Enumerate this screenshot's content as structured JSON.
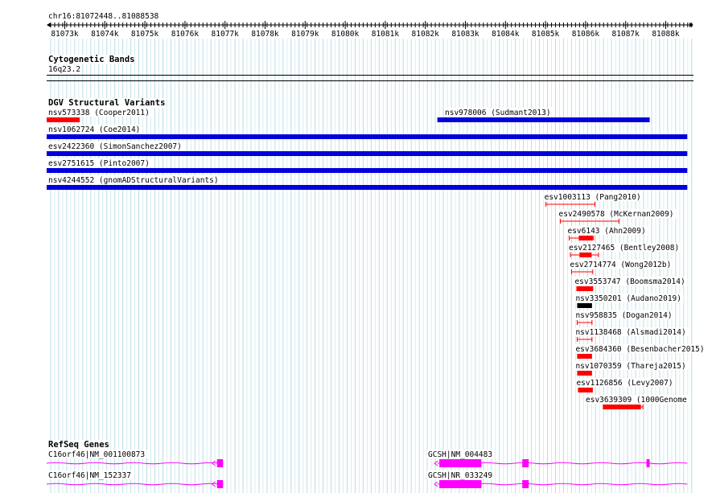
{
  "ruler": {
    "location": "chr16:81072448..81088538",
    "ticks": [
      "81073k",
      "81074k",
      "81075k",
      "81076k",
      "81077k",
      "81078k",
      "81079k",
      "81080k",
      "81081k",
      "81082k",
      "81083k",
      "81084k",
      "81085k",
      "81086k",
      "81087k",
      "81088k"
    ]
  },
  "cytoband": {
    "title": "Cytogenetic Bands",
    "band": "16q23.2"
  },
  "dgv": {
    "title": "DGV Structural Variants",
    "variants": [
      {
        "label": "nsv573338 (Cooper2011)",
        "start": 81072448,
        "end": 81073375,
        "color": "#ff0000",
        "style": "bar"
      },
      {
        "label": "nsv978006 (Sudmant2013)",
        "start": 81082300,
        "end": 81087600,
        "color": "#0000dd",
        "style": "bar"
      },
      {
        "label": "nsv1062724 (Coe2014)",
        "start": 81072448,
        "end": 81088538,
        "color": "#0000dd",
        "style": "bar"
      },
      {
        "label": "esv2422360 (SimonSanchez2007)",
        "start": 81072448,
        "end": 81088538,
        "color": "#0000dd",
        "style": "bar"
      },
      {
        "label": "esv2751615 (Pinto2007)",
        "start": 81072448,
        "end": 81088538,
        "color": "#0000dd",
        "style": "bar"
      },
      {
        "label": "nsv4244552 (gnomADStructuralVariants)",
        "start": 81072448,
        "end": 81088538,
        "color": "#0000dd",
        "style": "bar"
      },
      {
        "label": "esv1003113 (Pang2010)",
        "start": 81085010,
        "end": 81086230,
        "color": "#ff0000",
        "style": "span"
      },
      {
        "label": "esv2490578 (McKernan2009)",
        "start": 81085370,
        "end": 81086830,
        "color": "#ff0000",
        "style": "span"
      },
      {
        "label": "esv6143 (Ahn2009)",
        "start": 81085590,
        "end": 81086200,
        "color": "#ff0000",
        "style": "span-box",
        "box": [
          81085830,
          81086180
        ]
      },
      {
        "label": "esv2127465 (Bentley2008)",
        "start": 81085620,
        "end": 81086320,
        "color": "#ff0000",
        "style": "span-box",
        "box": [
          81085850,
          81086150
        ]
      },
      {
        "label": "esv2714774 (Wong2012b)",
        "start": 81085650,
        "end": 81086180,
        "color": "#ff0000",
        "style": "span"
      },
      {
        "label": "esv3553747 (Boomsma2014)",
        "start": 81085770,
        "end": 81086190,
        "color": "#ff0000",
        "style": "bar"
      },
      {
        "label": "nsv3350201 (Audano2019)",
        "start": 81085790,
        "end": 81086160,
        "color": "#000000",
        "style": "bar"
      },
      {
        "label": "nsv958835 (Dogan2014)",
        "start": 81085790,
        "end": 81086160,
        "color": "#ff0000",
        "style": "span"
      },
      {
        "label": "nsv1138468 (Alsmadi2014)",
        "start": 81085790,
        "end": 81086160,
        "color": "#ff0000",
        "style": "span"
      },
      {
        "label": "esv3684360 (Besenbacher2015)",
        "start": 81085790,
        "end": 81086160,
        "color": "#ff0000",
        "style": "bar"
      },
      {
        "label": "nsv1070359 (Thareja2015)",
        "start": 81085790,
        "end": 81086160,
        "color": "#ff0000",
        "style": "bar"
      },
      {
        "label": "esv1126856 (Levy2007)",
        "start": 81085810,
        "end": 81086180,
        "color": "#ff0000",
        "style": "bar"
      },
      {
        "label": "esv3639309 (1000Genome",
        "start": 81086440,
        "end": 81087430,
        "color": "#ff0000",
        "style": "span-box",
        "box": [
          81086440,
          81087380
        ]
      }
    ]
  },
  "refseq": {
    "title": "RefSeq Genes",
    "genes": [
      {
        "label": "C16orf46|NM_001100873",
        "color": "#ff00ff",
        "start": 81072448,
        "end": 81076950,
        "exons": [
          [
            81076800,
            81076950
          ]
        ],
        "arrow": "left"
      },
      {
        "label": "GCSH|NM_004483",
        "color": "#ff00ff",
        "start": 81082300,
        "end": 81088538,
        "exons": [
          [
            81082350,
            81083400
          ],
          [
            81084420,
            81084580
          ],
          [
            81087520,
            81087600
          ]
        ],
        "arrow": "left"
      },
      {
        "label": "C16orf46|NM_152337",
        "color": "#ff00ff",
        "start": 81072448,
        "end": 81076950,
        "exons": [
          [
            81076800,
            81076950
          ]
        ],
        "arrow": "left"
      },
      {
        "label": "GCSH|NR_033249",
        "color": "#ff00ff",
        "start": 81082300,
        "end": 81088538,
        "exons": [
          [
            81082350,
            81083400
          ],
          [
            81084420,
            81084580
          ]
        ],
        "arrow": "left"
      }
    ]
  }
}
